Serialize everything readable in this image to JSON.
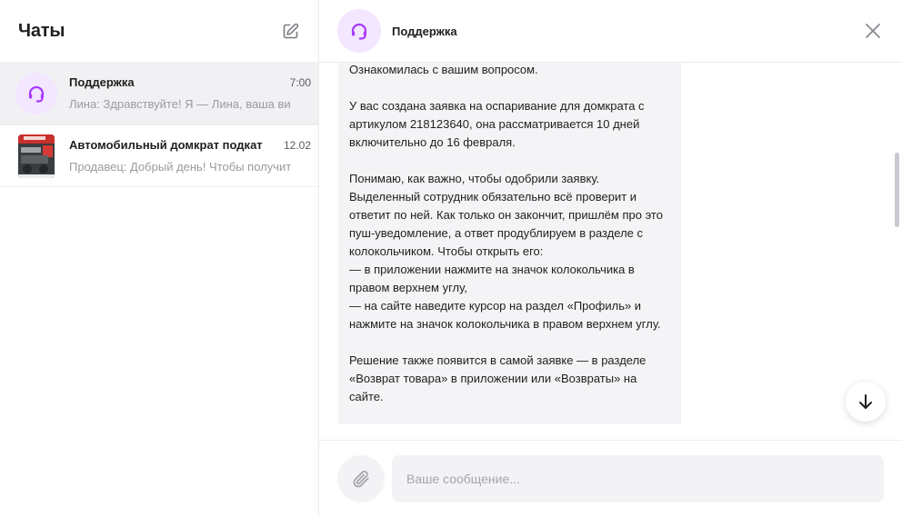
{
  "sidebar": {
    "title": "Чаты",
    "chats": [
      {
        "name": "Поддержка",
        "time": "7:00",
        "preview": "Лина: Здравствуйте! Я — Лина, ваша ви",
        "avatar": "headset-icon",
        "active": true
      },
      {
        "name": "Автомобильный домкрат подкат",
        "time": "12.02",
        "preview": "Продавец: Добрый день! Чтобы получит",
        "avatar": "product-thumbnail",
        "active": false
      }
    ]
  },
  "chat": {
    "title": "Поддержка",
    "message_text": "Ознакомилась с вашим вопросом.\n\nУ вас создана заявка на оспаривание для домкрата с артикулом 218123640, она рассматривается 10 дней включительно до 16 февраля.\n\nПонимаю, как важно, чтобы одобрили заявку. Выделенный сотрудник обязательно всё проверит и ответит по ней. Как только он закончит, пришлём про это пуш-уведомление, а ответ продублируем в разделе с колокольчиком. Чтобы открыть его:\n— в приложении нажмите на значок колокольчика в правом верхнем углу,\n— на сайте наведите курсор на раздел «Профиль» и нажмите на значок колокольчика в правом верхнем углу.\n\nРешение также появится в самой заявке — в разделе «Возврат товара» в приложении или «Возвраты» на сайте.",
    "input_placeholder": "Ваше сообщение..."
  },
  "colors": {
    "accent": "#a73afd",
    "avatar_bg": "#f3e6ff",
    "active_row": "#f1f1f4",
    "bubble": "#f4f4f7"
  }
}
